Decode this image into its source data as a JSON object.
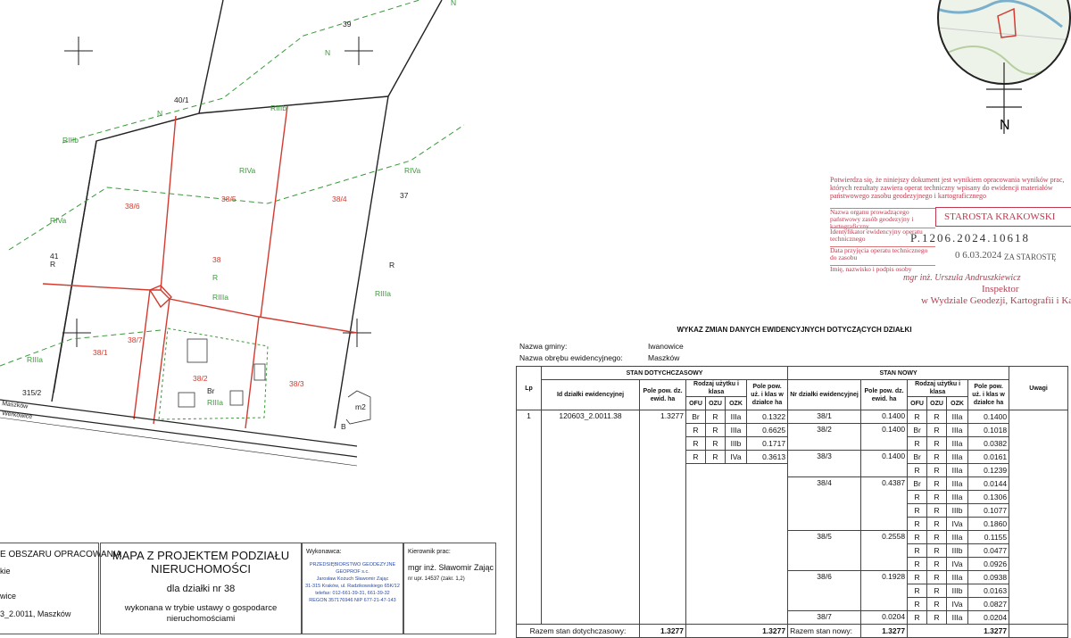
{
  "map": {
    "parcel_labels": [
      "40/1",
      "39",
      "37",
      "41",
      "315/2",
      "38/6",
      "38/5",
      "38/4",
      "38",
      "38/1",
      "38/7",
      "38/2",
      "38/3"
    ],
    "use_labels": {
      "n1": "N",
      "n2": "N",
      "n3": "N",
      "rilb": "RIIIb",
      "rilb2": "RIIIb",
      "riva1": "RIVa",
      "riva2": "RIVa",
      "riva3": "RIVa",
      "r1": "R",
      "r2": "R",
      "r3": "R",
      "rilla1": "RIIIa",
      "rilla2": "RIIIa",
      "rilla3": "RIIIa",
      "br": "Br",
      "rilla4": "RIIIa",
      "b": "B",
      "m2": "m2"
    },
    "road_labels": [
      "Maszków",
      "Werkowice"
    ]
  },
  "locator": {
    "north_label": "N"
  },
  "stamp": {
    "intro": "Potwierdza się, że niniejszy dokument jest wynikiem opracowania wyników prac, których rezultaty zawiera operat techniczny wpisany do ewidencji materiałów państwowego zasobu geodezyjnego i kartograficznego",
    "row1_label": "Nazwa organu prowadzącego państwowy zasób geodezyjny i kartograficzny",
    "row1_value": "STAROSTA KRAKOWSKI",
    "row2_label": "Identyfikator ewidencyjny operatu technicznego",
    "row2_value": "P.1206.2024.10618",
    "row3_label": "Data przyjęcia operatu technicznego do zasobu",
    "row3_value": "0 6.03.2024",
    "row4_label": "Imię, nazwisko i podpis osoby",
    "signer": "mgr inż. Urszula Andruszkiewicz",
    "signer_role": "Inspektor",
    "signer_dept": "w Wydziale Geodezji, Kartografii i Katastru",
    "overprint": "ZA STAROSTĘ"
  },
  "wykaz": {
    "title": "WYKAZ ZMIAN DANYCH EWIDENCYJNYCH DOTYCZĄCYCH DZIAŁKI",
    "gmina_label": "Nazwa gminy:",
    "gmina_value": "Iwanowice",
    "obreb_label": "Nazwa obrębu ewidencyjnego:",
    "obreb_value": "Maszków",
    "h_lp": "Lp",
    "h_stan_dot": "STAN DOTYCHCZASOWY",
    "h_stan_nowy": "STAN NOWY",
    "h_id": "Id działki ewidencyjnej",
    "h_pole_dz": "Pole pow. dz. ewid. ha",
    "h_rodzaj": "Rodzaj użytku i klasa",
    "h_ofu": "OFU",
    "h_ozu": "OZU",
    "h_ozk": "OZK",
    "h_pole_uz": "Pole pow. uż. i klas w działce ha",
    "h_nr": "Nr działki ewidencyjnej",
    "h_uwagi": "Uwagi",
    "lp": "1",
    "id": "120603_2.0011.38",
    "pole_dz": "1.3277",
    "old_uses": [
      {
        "ofu": "Br",
        "ozu": "R",
        "ozk": "IIIa",
        "pole": "0.1322"
      },
      {
        "ofu": "R",
        "ozu": "R",
        "ozk": "IIIa",
        "pole": "0.6625"
      },
      {
        "ofu": "R",
        "ozu": "R",
        "ozk": "IIIb",
        "pole": "0.1717"
      },
      {
        "ofu": "R",
        "ozu": "R",
        "ozk": "IVa",
        "pole": "0.3613"
      }
    ],
    "new_parcels": [
      {
        "nr": "38/1",
        "pole": "0.1400",
        "uses": [
          {
            "ofu": "R",
            "ozu": "R",
            "ozk": "IIIa",
            "pole": "0.1400"
          }
        ]
      },
      {
        "nr": "38/2",
        "pole": "0.1400",
        "uses": [
          {
            "ofu": "Br",
            "ozu": "R",
            "ozk": "IIIa",
            "pole": "0.1018"
          },
          {
            "ofu": "R",
            "ozu": "R",
            "ozk": "IIIa",
            "pole": "0.0382"
          }
        ]
      },
      {
        "nr": "38/3",
        "pole": "0.1400",
        "uses": [
          {
            "ofu": "Br",
            "ozu": "R",
            "ozk": "IIIa",
            "pole": "0.0161"
          },
          {
            "ofu": "R",
            "ozu": "R",
            "ozk": "IIIa",
            "pole": "0.1239"
          }
        ]
      },
      {
        "nr": "38/4",
        "pole": "0.4387",
        "uses": [
          {
            "ofu": "Br",
            "ozu": "R",
            "ozk": "IIIa",
            "pole": "0.0144"
          },
          {
            "ofu": "R",
            "ozu": "R",
            "ozk": "IIIa",
            "pole": "0.1306"
          },
          {
            "ofu": "R",
            "ozu": "R",
            "ozk": "IIIb",
            "pole": "0.1077"
          },
          {
            "ofu": "R",
            "ozu": "R",
            "ozk": "IVa",
            "pole": "0.1860"
          }
        ]
      },
      {
        "nr": "38/5",
        "pole": "0.2558",
        "uses": [
          {
            "ofu": "R",
            "ozu": "R",
            "ozk": "IIIa",
            "pole": "0.1155"
          },
          {
            "ofu": "R",
            "ozu": "R",
            "ozk": "IIIb",
            "pole": "0.0477"
          },
          {
            "ofu": "R",
            "ozu": "R",
            "ozk": "IVa",
            "pole": "0.0926"
          }
        ]
      },
      {
        "nr": "38/6",
        "pole": "0.1928",
        "uses": [
          {
            "ofu": "R",
            "ozu": "R",
            "ozk": "IIIa",
            "pole": "0.0938"
          },
          {
            "ofu": "R",
            "ozu": "R",
            "ozk": "IIIb",
            "pole": "0.0163"
          },
          {
            "ofu": "R",
            "ozu": "R",
            "ozk": "IVa",
            "pole": "0.0827"
          }
        ]
      },
      {
        "nr": "38/7",
        "pole": "0.0204",
        "uses": [
          {
            "ofu": "R",
            "ozu": "R",
            "ozk": "IIIa",
            "pole": "0.0204"
          }
        ]
      }
    ],
    "sum_old_label": "Razem stan dotychczasowy:",
    "sum_old_a": "1.3277",
    "sum_old_b": "1.3277",
    "sum_new_label": "Razem stan nowy:",
    "sum_new_a": "1.3277",
    "sum_new_b": "1.3277"
  },
  "panels": {
    "area_title": "E OBSZARU OPRACOWANIA",
    "area_lines": [
      "kie",
      "wice",
      "3_2.0011, Maszków"
    ],
    "map_title1": "MAPA Z PROJEKTEM PODZIAŁU",
    "map_title2": "NIERUCHOMOŚCI",
    "map_for": "dla działki nr 38",
    "map_done1": "wykonana w trybie ustawy o gospodarce",
    "map_done2": "nieruchomościami",
    "exec_label": "Wykonawca:",
    "exec_lines": [
      "PRZEDSIĘBIORSTWO GEODEZYJNE",
      "GEOPROF s.c.",
      "Jarosław Kożuch Sławomir Zając",
      "31-315 Kraków, ul. Radzikowskiego 65K/12",
      "telefax: 012-661-39-31, 661-39-32",
      "REGON 357176946 NIP 677-21-47-143"
    ],
    "kier_label": "Kierownik prac:",
    "kier_name": "mgr inż. Sławomir Zając",
    "kier_uprawn": "nr upr. 14537 (zakr. 1,2)"
  }
}
